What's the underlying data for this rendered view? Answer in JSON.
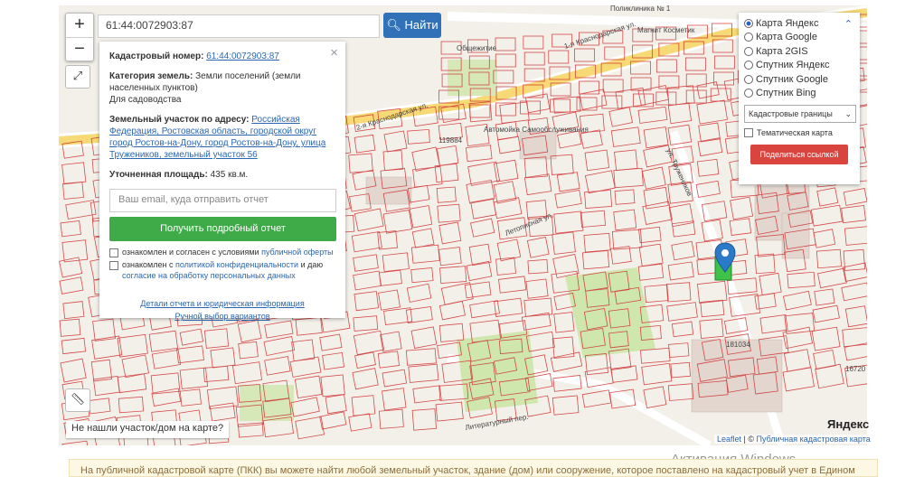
{
  "search": {
    "value": "61:44:0072903:87",
    "button": "Найти"
  },
  "zoom": {
    "plus": "+",
    "minus": "−"
  },
  "panel": {
    "cadastral_label": "Кадастровый номер:",
    "cadastral_value": "61:44:0072903:87",
    "category_label": "Категория земель:",
    "category_value": "Земли поселений (земли населенных пунктов)",
    "use": "Для садоводства",
    "address_label": "Земельный участок по адресу:",
    "address_value": "Российская Федерация, Ростовская область, городской округ город Ростов-на-Дону, город Ростов-на-Дону, улица Тружеников, земельный участок 56",
    "area_label": "Уточненная площадь:",
    "area_value": "435 кв.м.",
    "email_placeholder": "Ваш email, куда отправить отчет",
    "get_report": "Получить подробный отчет",
    "agree1_pre": "ознакомлен и согласен с условиями ",
    "agree1_link": "публичной оферты",
    "agree2_pre": "ознакомлен с ",
    "agree2_link1": "политикой конфиденциальности",
    "agree2_mid": " и даю ",
    "agree2_link2": "согласие на обработку персональных данных",
    "details_link": "Детали отчета и юридическая информация",
    "manual_link": "Ручной выбор вариантов"
  },
  "layers": {
    "options": [
      "Карта Яндекс",
      "Карта Google",
      "Карта 2GIS",
      "Спутник Яндекс",
      "Спутник Google",
      "Спутник Bing"
    ],
    "selected": "Карта Яндекс",
    "overlay_select": "Кадастровые границы",
    "thematic": "Тематическая карта",
    "share": "Поделиться ссылкой"
  },
  "map_labels": {
    "street1": "2-я Краснодарская ул.",
    "street2": "1-я Краснодарская ул.",
    "street3": "ул. Тружеников",
    "street4": "Литературный пер.",
    "street5": "Летописная ул.",
    "poi1": "Общежитие",
    "poi2": "Автомойка Самообслуживания",
    "poi3": "Магнит Косметик",
    "poi4": "Поликлиника № 1",
    "num1": "119884",
    "num2": "181034",
    "num3": "16720"
  },
  "not_found": "Не нашли участок/дом на карте?",
  "attribution": {
    "leaflet": "Leaflet",
    "sep": " | © ",
    "pkk": "Публичная кадастровая карта"
  },
  "yandex": "Яндекс",
  "windows": "Активация Windows",
  "bottom_notice": "На публичной кадастровой карте (ПКК) вы можете найти любой земельный участок, здание (дом) или сооружение, которое поставлено на кадастровый учет в Едином"
}
